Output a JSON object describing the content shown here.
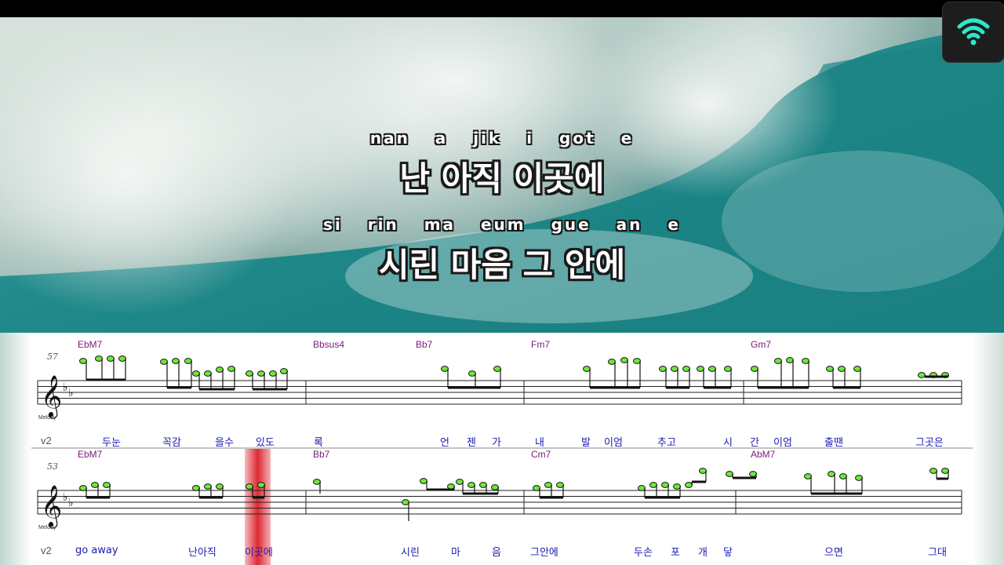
{
  "karaoke": {
    "line1_roman": "nan  a  jik  i got e",
    "line1_hangul": "난 아직 이곳에",
    "line2_roman": "si rin  ma eum gue  an  e",
    "line2_hangul": "시린 마음 그 안에"
  },
  "staff1": {
    "measure_number": "57",
    "clef_label": "Melody",
    "chords": [
      "EbM7",
      "Bbsus4",
      "Bb7",
      "Fm7",
      "Gm7"
    ],
    "verse": "v2",
    "lyrics": [
      "두눈",
      "꼭감",
      "을수",
      "있도",
      "록",
      "언",
      "젠",
      "가",
      "내",
      "발",
      "이엄",
      "추고",
      "시",
      "간",
      "이엄",
      "출땐",
      "그곳은"
    ]
  },
  "staff2": {
    "measure_number": "53",
    "clef_label": "Melody",
    "chords": [
      "EbM7",
      "Bb7",
      "Cm7",
      "AbM7"
    ],
    "verse": "v2",
    "lyrics": [
      "go away",
      "난아직",
      "이곳에",
      "시린",
      "마",
      "음",
      "그안에",
      "두손",
      "포",
      "개",
      "닿",
      "으면",
      "그대"
    ]
  },
  "colors": {
    "highlight_note": "#6ee83a",
    "cursor": "#e3343f",
    "chord_text": "#7a1a7a",
    "lyric_text": "#1a1ab0",
    "wifi_icon": "#2ee6c9"
  }
}
